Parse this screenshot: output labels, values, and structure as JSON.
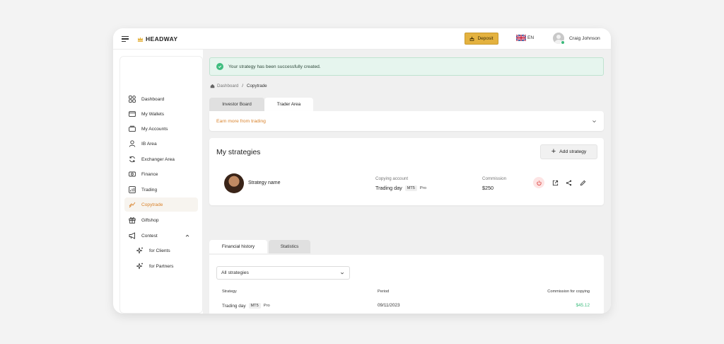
{
  "brand": {
    "name": "HEADWAY",
    "accent": "#e4b23f"
  },
  "topbar": {
    "deposit_label": "Deposit",
    "language": "EN",
    "user_name": "Craig Johnson"
  },
  "sidebar": {
    "items": [
      {
        "label": "Dashboard",
        "icon": "dashboard-icon"
      },
      {
        "label": "My Wallets",
        "icon": "wallet-icon"
      },
      {
        "label": "My Accounts",
        "icon": "accounts-icon"
      },
      {
        "label": "IB Area",
        "icon": "user-icon"
      },
      {
        "label": "Exchanger Area",
        "icon": "exchange-icon"
      },
      {
        "label": "Finance",
        "icon": "finance-icon"
      },
      {
        "label": "Trading",
        "icon": "chart-icon"
      },
      {
        "label": "Copytrade",
        "icon": "copytrade-icon"
      },
      {
        "label": "Giftshop",
        "icon": "gift-icon"
      },
      {
        "label": "Contest",
        "icon": "megaphone-icon"
      },
      {
        "label": "for Clients",
        "icon": "sparkle-icon"
      },
      {
        "label": "for Partners",
        "icon": "sparkle-icon"
      }
    ],
    "active": "Copytrade",
    "active_color": "#d9822b"
  },
  "alert": {
    "message": "Your strategy has been successfully created."
  },
  "breadcrumb": {
    "home": "Dashboard",
    "current": "Copytrade"
  },
  "tabs": {
    "investor": "Investor Board",
    "trader": "Trader Area"
  },
  "earn": {
    "label": "Earn more from trading"
  },
  "strategies": {
    "title": "My strategies",
    "add_label": "Add strategy",
    "item": {
      "name": "Strategy name",
      "copying_label": "Copying account",
      "account_name": "Trading day",
      "platform": "MT5",
      "type": "Pro",
      "commission_label": "Commission",
      "commission_value": "$250"
    }
  },
  "history_tabs": {
    "financial": "Financial history",
    "statistics": "Statistics"
  },
  "history": {
    "filter_value": "All strategies",
    "columns": {
      "strategy": "Strategy",
      "period": "Period",
      "commission": "Commission for copying"
    },
    "rows": [
      {
        "strategy": "Trading day",
        "platform": "MT5",
        "type": "Pro",
        "period": "09/11/2023",
        "commission": "$45.12"
      }
    ],
    "amount_color": "#3fbd7f"
  }
}
